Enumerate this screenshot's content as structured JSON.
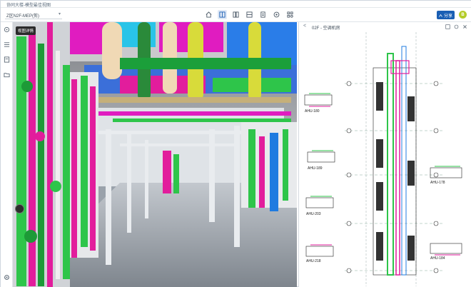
{
  "window": {
    "title": "协同大楼-模型最佳视图"
  },
  "toolbar": {
    "model_select": "Z区N2F-MEP(剪)",
    "share_label": "分享",
    "avatar_initial": "B",
    "icons": [
      "home-icon",
      "split-view-icon",
      "compare-icon",
      "section-icon",
      "document-icon",
      "target-icon",
      "settings-icon"
    ]
  },
  "viewport": {
    "badge": "视图详情"
  },
  "panel": {
    "back_label": "<",
    "title": "02F - 空调机房",
    "labels": [
      "AHU-180",
      "AHU-189",
      "AHU-218",
      "AHU-178",
      "AHU-184",
      "AHU-203"
    ]
  },
  "colors": {
    "accent": "#1a5fb4",
    "pipe_green": "#2ec54a",
    "pipe_magenta": "#e41f9b",
    "pipe_blue": "#1f7be0"
  }
}
